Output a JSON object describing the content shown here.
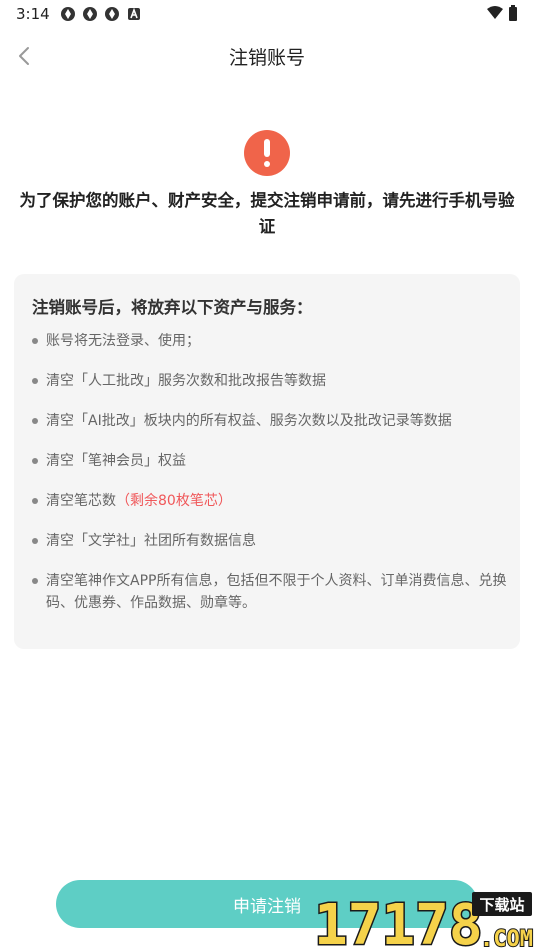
{
  "status_bar": {
    "time": "3:14",
    "left_icons": [
      "app-notification-icon",
      "app-notification-icon",
      "app-notification-icon",
      "a-badge-icon"
    ],
    "right_icons": [
      "wifi-icon",
      "battery-icon"
    ]
  },
  "nav": {
    "title": "注销账号",
    "back_icon": "chevron-left-icon"
  },
  "alert": {
    "icon": "exclamation-icon",
    "color": "#f0644a"
  },
  "warning": "为了保护您的账户、财产安全，提交注销申请前，请先进行手机号验证",
  "card": {
    "title": "注销账号后，将放弃以下资产与服务：",
    "items": [
      {
        "text": "账号将无法登录、使用；"
      },
      {
        "text": "清空「人工批改」服务次数和批改报告等数据"
      },
      {
        "text": "清空「AI批改」板块内的所有权益、服务次数以及批改记录等数据"
      },
      {
        "text": "清空「笔神会员」权益"
      },
      {
        "text": "清空笔芯数",
        "highlight": "（剩余80枚笔芯）"
      },
      {
        "text": "清空「文学社」社团所有数据信息"
      },
      {
        "text": "清空笔神作文APP所有信息，包括但不限于个人资料、订单消费信息、兑换码、优惠券、作品数据、勋章等。"
      }
    ]
  },
  "submit_button": {
    "label": "申请注销",
    "color": "#5ecec5"
  },
  "watermark": {
    "number": "17178",
    "badge": "下载站",
    "domain": ".COM"
  }
}
